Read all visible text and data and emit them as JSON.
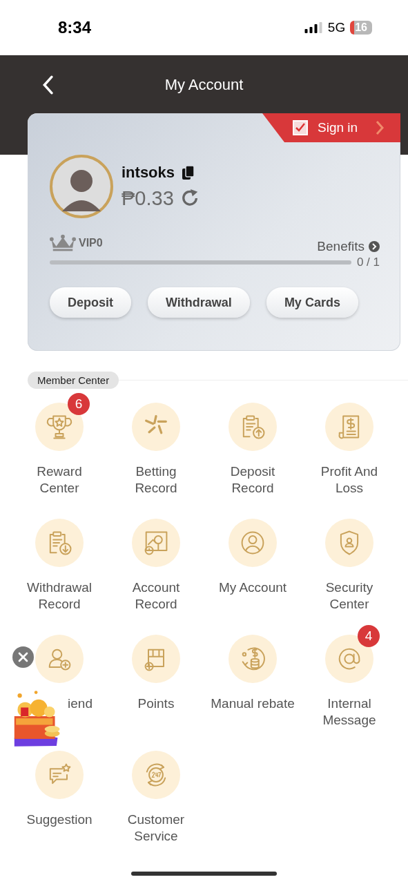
{
  "status_bar": {
    "time": "8:34",
    "network": "5G",
    "battery": "16"
  },
  "header": {
    "title": "My Account"
  },
  "account_card": {
    "sign_in": "Sign in",
    "username": "intsoks",
    "balance": "₱0.33",
    "vip_level": "VIP0",
    "benefits": "Benefits",
    "progress": {
      "level": 0,
      "reading": "0 / 1"
    },
    "buttons": [
      "Deposit",
      "Withdrawal",
      "My Cards"
    ]
  },
  "member_center": {
    "title": "Member Center",
    "items": [
      {
        "label": "Reward Center",
        "badge": "6"
      },
      {
        "label": "Betting Record"
      },
      {
        "label": "Deposit Record"
      },
      {
        "label": "Profit And Loss"
      },
      {
        "label": "Withdrawal Record"
      },
      {
        "label": "Account Record"
      },
      {
        "label": "My Account"
      },
      {
        "label": "Security Center"
      },
      {
        "label": "iend"
      },
      {
        "label": "Points"
      },
      {
        "label": "Manual rebate"
      },
      {
        "label": "Internal Message",
        "badge": "4"
      },
      {
        "label": "Suggestion"
      },
      {
        "label": "Customer Service"
      }
    ]
  }
}
